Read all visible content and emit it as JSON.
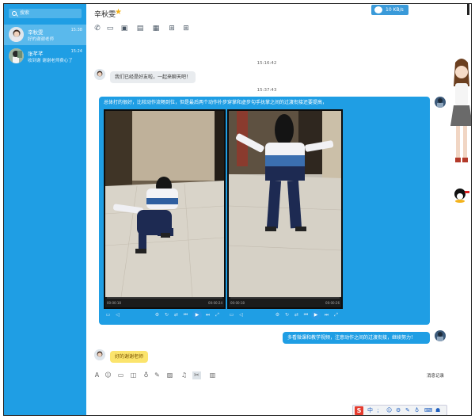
{
  "sidebar": {
    "search_placeholder": "搜索",
    "contacts": [
      {
        "name": "辛秋雯",
        "message": "好的谢谢老师",
        "time": "15:38"
      },
      {
        "name": "张芊芊",
        "message": "收到谢 谢谢老师费心了",
        "time": "15:24"
      }
    ]
  },
  "header": {
    "title": "辛秋雯",
    "speed": "10 KB/s"
  },
  "chat": {
    "time1": "15:16:42",
    "msg1": "我们已经是好友啦，一起来聊天吧！",
    "time2": "15:37:43",
    "msg2": "总体打的很好，比较动作流畅到位，但是最后两个动作扑步穿掌和虚步勾手抚掌之间的过渡衔接还要提高，",
    "video1": {
      "start": "00:00:18",
      "end": "00:00:24"
    },
    "video2": {
      "start": "00:00:18",
      "end": "00:00:26"
    },
    "msg3": "多看微课和教学视频，注意动作之间的过渡衔接，继续努力！",
    "msg4": "好的谢谢老师"
  },
  "input": {
    "history": "消息记录"
  },
  "ime": {
    "logo": "S",
    "label": "中"
  }
}
